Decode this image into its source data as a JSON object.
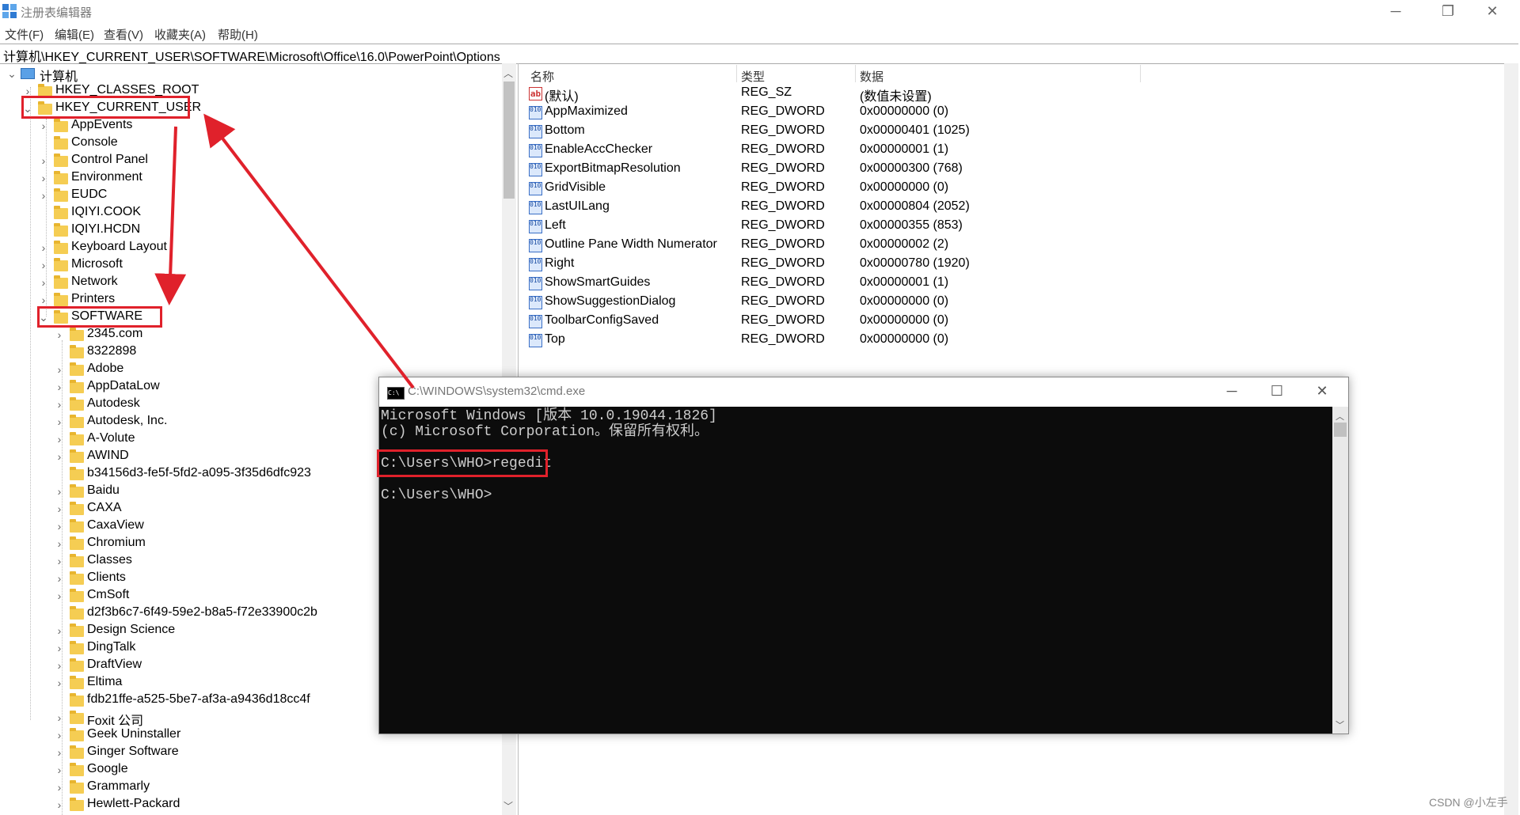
{
  "window": {
    "title": "注册表编辑器",
    "menu": [
      "文件(F)",
      "编辑(E)",
      "查看(V)",
      "收藏夹(A)",
      "帮助(H)"
    ],
    "address": "计算机\\HKEY_CURRENT_USER\\SOFTWARE\\Microsoft\\Office\\16.0\\PowerPoint\\Options"
  },
  "tree": {
    "root": "计算机",
    "hives": [
      "HKEY_CLASSES_ROOT",
      "HKEY_CURRENT_USER"
    ],
    "hkcu_children": [
      "AppEvents",
      "Console",
      "Control Panel",
      "Environment",
      "EUDC",
      "IQIYI.COOK",
      "IQIYI.HCDN",
      "Keyboard Layout",
      "Microsoft",
      "Network",
      "Printers",
      "SOFTWARE"
    ],
    "software_children": [
      "2345.com",
      "8322898",
      "Adobe",
      "AppDataLow",
      "Autodesk",
      "Autodesk, Inc.",
      "A-Volute",
      "AWIND",
      "b34156d3-fe5f-5fd2-a095-3f35d6dfc923",
      "Baidu",
      "CAXA",
      "CaxaView",
      "Chromium",
      "Classes",
      "Clients",
      "CmSoft",
      "d2f3b6c7-6f49-59e2-b8a5-f72e33900c2b",
      "Design Science",
      "DingTalk",
      "DraftView",
      "Eltima",
      "fdb21ffe-a525-5be7-af3a-a9436d18cc4f",
      "Foxit 公司",
      "Geek Uninstaller",
      "Ginger Software",
      "Google",
      "Grammarly",
      "Hewlett-Packard"
    ]
  },
  "values": {
    "headers": {
      "name": "名称",
      "type": "类型",
      "data": "数据"
    },
    "rows": [
      {
        "icon": "string-value-icon",
        "name": "(默认)",
        "type": "REG_SZ",
        "data": "(数值未设置)"
      },
      {
        "icon": "dword-value-icon",
        "name": "AppMaximized",
        "type": "REG_DWORD",
        "data": "0x00000000 (0)"
      },
      {
        "icon": "dword-value-icon",
        "name": "Bottom",
        "type": "REG_DWORD",
        "data": "0x00000401 (1025)"
      },
      {
        "icon": "dword-value-icon",
        "name": "EnableAccChecker",
        "type": "REG_DWORD",
        "data": "0x00000001 (1)"
      },
      {
        "icon": "dword-value-icon",
        "name": "ExportBitmapResolution",
        "type": "REG_DWORD",
        "data": "0x00000300 (768)"
      },
      {
        "icon": "dword-value-icon",
        "name": "GridVisible",
        "type": "REG_DWORD",
        "data": "0x00000000 (0)"
      },
      {
        "icon": "dword-value-icon",
        "name": "LastUILang",
        "type": "REG_DWORD",
        "data": "0x00000804 (2052)"
      },
      {
        "icon": "dword-value-icon",
        "name": "Left",
        "type": "REG_DWORD",
        "data": "0x00000355 (853)"
      },
      {
        "icon": "dword-value-icon",
        "name": "Outline Pane Width Numerator",
        "type": "REG_DWORD",
        "data": "0x00000002 (2)"
      },
      {
        "icon": "dword-value-icon",
        "name": "Right",
        "type": "REG_DWORD",
        "data": "0x00000780 (1920)"
      },
      {
        "icon": "dword-value-icon",
        "name": "ShowSmartGuides",
        "type": "REG_DWORD",
        "data": "0x00000001 (1)"
      },
      {
        "icon": "dword-value-icon",
        "name": "ShowSuggestionDialog",
        "type": "REG_DWORD",
        "data": "0x00000000 (0)"
      },
      {
        "icon": "dword-value-icon",
        "name": "ToolbarConfigSaved",
        "type": "REG_DWORD",
        "data": "0x00000000 (0)"
      },
      {
        "icon": "dword-value-icon",
        "name": "Top",
        "type": "REG_DWORD",
        "data": "0x00000000 (0)"
      }
    ]
  },
  "cmd": {
    "title": "C:\\WINDOWS\\system32\\cmd.exe",
    "lines": [
      "Microsoft Windows [版本 10.0.19044.1826]",
      "(c) Microsoft Corporation。保留所有权利。",
      "",
      "C:\\Users\\WHO>regedit",
      "",
      "C:\\Users\\WHO>"
    ]
  },
  "watermark": "CSDN @小左手",
  "colors": {
    "highlight": "#e0212b",
    "folder": "#f5cd53",
    "console_bg": "#0c0c0c"
  }
}
